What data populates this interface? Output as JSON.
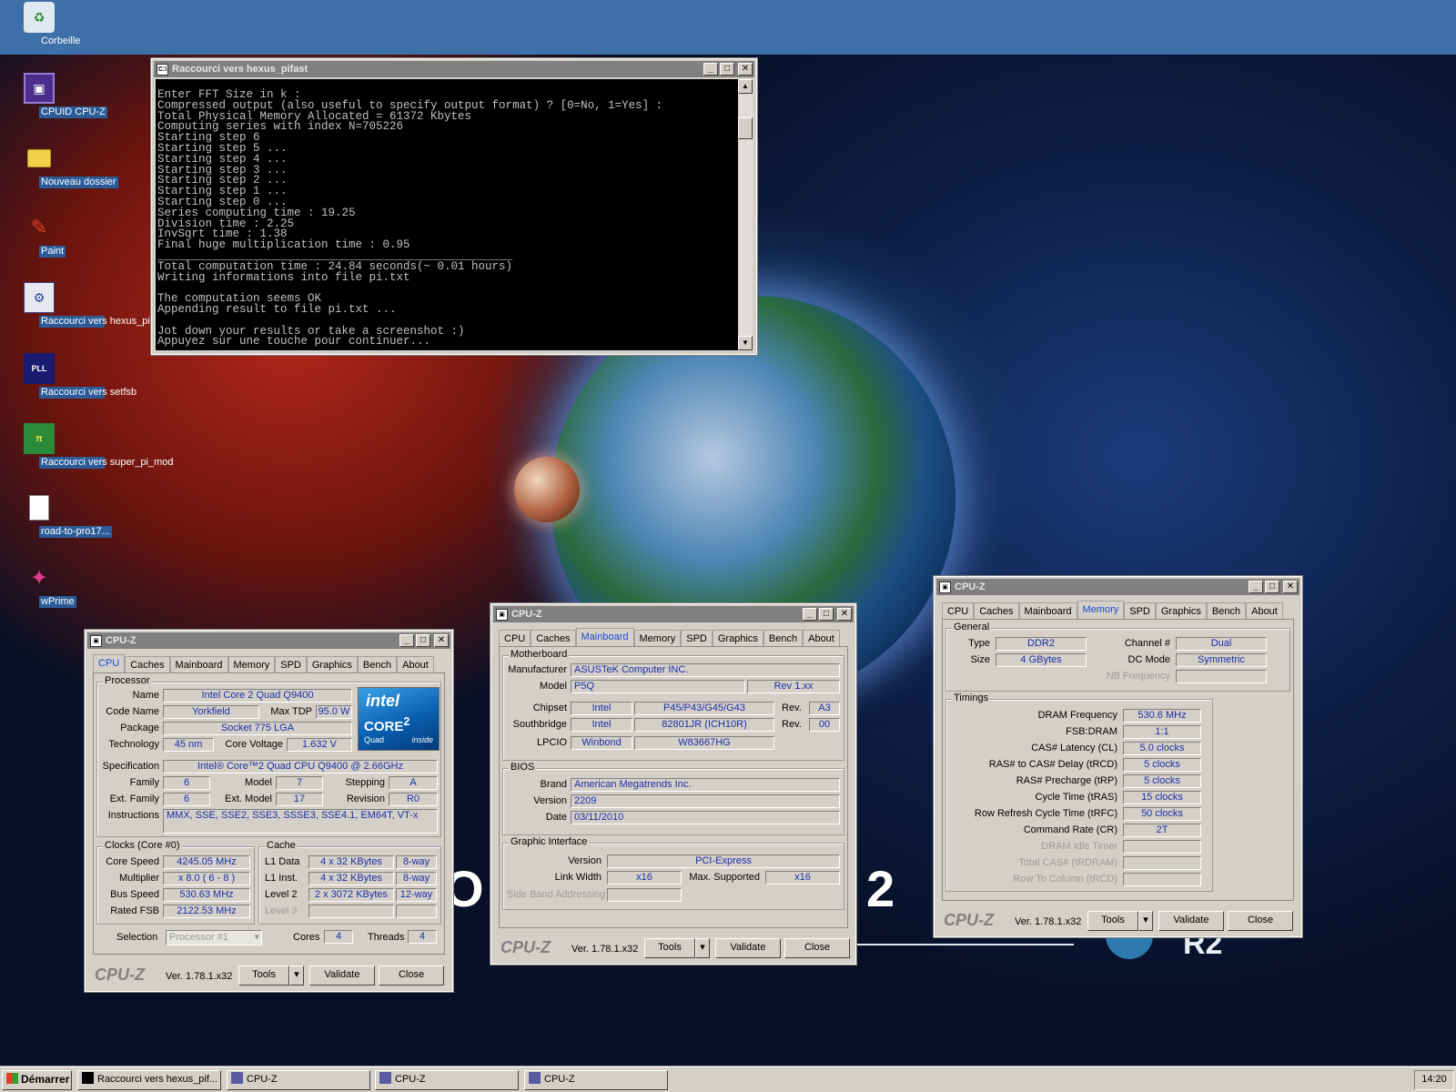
{
  "desktop": {
    "icons": [
      {
        "label": "Corbeille",
        "icon": "recycle-bin-icon"
      },
      {
        "label": "CPUID CPU-Z",
        "icon": "cpuz-chip-icon"
      },
      {
        "label": "Nouveau dossier",
        "icon": "folder-icon"
      },
      {
        "label": "Paint",
        "icon": "paint-icon"
      },
      {
        "label": "Raccourci vers hexus_pifast",
        "icon": "hexus-pifast-icon"
      },
      {
        "label": "Raccourci vers setfsb",
        "icon": "setfsb-icon"
      },
      {
        "label": "Raccourci vers super_pi_mod",
        "icon": "superpi-icon"
      },
      {
        "label": "road-to-pro17...",
        "icon": "document-icon"
      },
      {
        "label": "wPrime",
        "icon": "wprime-icon"
      }
    ],
    "wallpaper_text": {
      "left_char": "O",
      "right_char": "2",
      "badge": "R2"
    }
  },
  "console": {
    "title": "Raccourci vers hexus_pifast",
    "lines": [
      "Enter FFT Size in k :",
      "Compressed output (also useful to specify output format) ? [0=No, 1=Yes] :",
      "Total Physical Memory Allocated = 61372 Kbytes",
      "Computing series with index N=705226",
      "Starting step 6",
      "Starting step 5 ...",
      "Starting step 4 ...",
      "Starting step 3 ...",
      "Starting step 2 ...",
      "Starting step 1 ...",
      "Starting step 0 ...",
      "Series computing time : 19.25",
      "Division time : 2.25",
      "InvSqrt time : 1.38",
      "Final huge multiplication time : 0.95",
      "____________________________________________________",
      "Total computation time : 24.84 seconds(~ 0.01 hours)",
      "Writing informations into file pi.txt",
      "",
      "The computation seems OK",
      "Appending result to file pi.txt ...",
      "",
      "Jot down your results or take a screenshot :)",
      "Appuyez sur une touche pour continuer..."
    ]
  },
  "cpuz_common": {
    "title": "CPU-Z",
    "tabs": [
      "CPU",
      "Caches",
      "Mainboard",
      "Memory",
      "SPD",
      "Graphics",
      "Bench",
      "About"
    ],
    "logo": "CPU-Z",
    "version": "Ver. 1.78.1.x32",
    "tools": "Tools",
    "validate": "Validate",
    "close": "Close"
  },
  "cpu": {
    "processor_group": "Processor",
    "name_label": "Name",
    "name": "Intel Core 2 Quad Q9400",
    "codename_label": "Code Name",
    "codename": "Yorkfield",
    "maxtdp_label": "Max TDP",
    "maxtdp": "95.0 W",
    "package_label": "Package",
    "package": "Socket 775 LGA",
    "technology_label": "Technology",
    "technology": "45 nm",
    "corevoltage_label": "Core Voltage",
    "corevoltage": "1.632 V",
    "spec_label": "Specification",
    "spec": "Intel® Core™2 Quad CPU   Q9400  @ 2.66GHz",
    "family_label": "Family",
    "family": "6",
    "model_label": "Model",
    "model": "7",
    "stepping_label": "Stepping",
    "stepping": "A",
    "extfamily_label": "Ext. Family",
    "extfamily": "6",
    "extmodel_label": "Ext. Model",
    "extmodel": "17",
    "revision_label": "Revision",
    "revision": "R0",
    "instructions_label": "Instructions",
    "instructions": "MMX, SSE, SSE2, SSE3, SSSE3, SSE4.1, EM64T, VT-x",
    "clocks_group": "Clocks (Core #0)",
    "corespeed_label": "Core Speed",
    "corespeed": "4245.05 MHz",
    "multiplier_label": "Multiplier",
    "multiplier": "x 8.0 ( 6 - 8 )",
    "busspeed_label": "Bus Speed",
    "busspeed": "530.63 MHz",
    "ratedfsb_label": "Rated FSB",
    "ratedfsb": "2122.53 MHz",
    "cache_group": "Cache",
    "l1data_label": "L1 Data",
    "l1data": "4 x 32 KBytes",
    "l1data_way": "8-way",
    "l1inst_label": "L1 Inst.",
    "l1inst": "4 x 32 KBytes",
    "l1inst_way": "8-way",
    "level2_label": "Level 2",
    "level2": "2 x 3072 KBytes",
    "level2_way": "12-way",
    "level3_label": "Level 3",
    "selection_label": "Selection",
    "selection": "Processor #1",
    "cores_label": "Cores",
    "cores": "4",
    "threads_label": "Threads",
    "threads": "4",
    "intel_logo": {
      "brand": "intel",
      "product": "CORE",
      "sup": "2",
      "line": "Quad",
      "inside": "inside"
    }
  },
  "mainboard": {
    "motherboard_group": "Motherboard",
    "manufacturer_label": "Manufacturer",
    "manufacturer": "ASUSTeK Computer INC.",
    "model_label": "Model",
    "model": "P5Q",
    "model_rev": "Rev 1.xx",
    "chipset_label": "Chipset",
    "chipset_vendor": "Intel",
    "chipset": "P45/P43/G45/G43",
    "chipset_rev_label": "Rev.",
    "chipset_rev": "A3",
    "southbridge_label": "Southbridge",
    "sb_vendor": "Intel",
    "southbridge": "82801JR (ICH10R)",
    "sb_rev_label": "Rev.",
    "sb_rev": "00",
    "lpcio_label": "LPCIO",
    "lpcio_vendor": "Winbond",
    "lpcio": "W83667HG",
    "bios_group": "BIOS",
    "brand_label": "Brand",
    "brand": "American Megatrends Inc.",
    "version_label": "Version",
    "version": "2209",
    "date_label": "Date",
    "date": "03/11/2010",
    "graphic_group": "Graphic Interface",
    "gi_version_label": "Version",
    "gi_version": "PCI-Express",
    "linkwidth_label": "Link Width",
    "linkwidth": "x16",
    "maxsupported_label": "Max. Supported",
    "maxsupported": "x16",
    "sideband_label": "Side Band Addressing"
  },
  "memory": {
    "general_group": "General",
    "type_label": "Type",
    "type": "DDR2",
    "channel_label": "Channel #",
    "channel": "Dual",
    "size_label": "Size",
    "size": "4 GBytes",
    "dcmode_label": "DC Mode",
    "dcmode": "Symmetric",
    "nbfreq_label": "NB Frequency",
    "timings_group": "Timings",
    "timings": [
      {
        "label": "DRAM Frequency",
        "value": "530.6 MHz",
        "disabled": false
      },
      {
        "label": "FSB:DRAM",
        "value": "1:1",
        "disabled": false
      },
      {
        "label": "CAS# Latency (CL)",
        "value": "5.0 clocks",
        "disabled": false
      },
      {
        "label": "RAS# to CAS# Delay (tRCD)",
        "value": "5 clocks",
        "disabled": false
      },
      {
        "label": "RAS# Precharge (tRP)",
        "value": "5 clocks",
        "disabled": false
      },
      {
        "label": "Cycle Time (tRAS)",
        "value": "15 clocks",
        "disabled": false
      },
      {
        "label": "Row Refresh Cycle Time (tRFC)",
        "value": "50 clocks",
        "disabled": false
      },
      {
        "label": "Command Rate (CR)",
        "value": "2T",
        "disabled": false
      },
      {
        "label": "DRAM Idle Timer",
        "value": "",
        "disabled": true
      },
      {
        "label": "Total CAS# (tRDRAM)",
        "value": "",
        "disabled": true
      },
      {
        "label": "Row To Column (tRCD)",
        "value": "",
        "disabled": true
      }
    ]
  },
  "taskbar": {
    "start": "Démarrer",
    "tasks": [
      "Raccourci vers hexus_pif...",
      "CPU-Z",
      "CPU-Z",
      "CPU-Z"
    ],
    "clock": "14:20"
  }
}
